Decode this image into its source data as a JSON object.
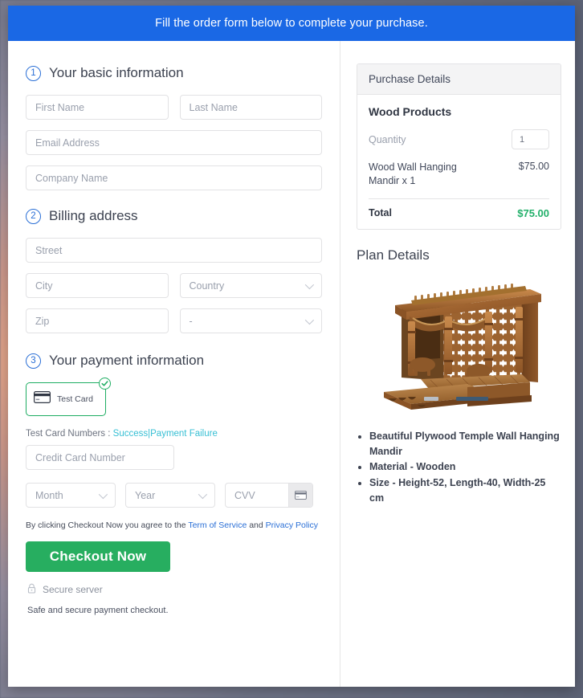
{
  "banner": {
    "text": "Fill the order form below to complete your purchase."
  },
  "sections": {
    "basic": {
      "step": "1",
      "title": "Your basic information",
      "fields": {
        "first_name": "First Name",
        "last_name": "Last Name",
        "email": "Email Address",
        "company": "Company Name"
      }
    },
    "billing": {
      "step": "2",
      "title": "Billing address",
      "fields": {
        "street": "Street",
        "city": "City",
        "country": "Country",
        "zip": "Zip",
        "state": "-"
      }
    },
    "payment": {
      "step": "3",
      "title": "Your payment information",
      "method_label": "Test Card",
      "testcards_prefix": "Test Card Numbers :",
      "testcards_success": "Success",
      "testcards_separator": "|",
      "testcards_failure": "Payment Failure",
      "fields": {
        "card_number": "Credit Card Number",
        "month": "Month",
        "year": "Year",
        "cvv": "CVV"
      }
    }
  },
  "footer": {
    "terms_prefix": "By clicking Checkout Now you agree to the",
    "terms_link": "Term of Service",
    "terms_and": "and",
    "privacy_link": "Privacy Policy",
    "checkout_label": "Checkout Now",
    "secure_server": "Secure server",
    "safe_note": "Safe and secure payment checkout."
  },
  "purchase": {
    "header": "Purchase Details",
    "product_group": "Wood Products",
    "quantity_label": "Quantity",
    "quantity_value": "1",
    "line_item_name": "Wood Wall Hanging Mandir x 1",
    "line_item_amount": "$75.00",
    "total_label": "Total",
    "total_amount": "$75.00"
  },
  "plan": {
    "title": "Plan Details",
    "bullets": [
      "Beautiful Plywood Temple Wall Hanging Mandir",
      "Material - Wooden",
      "Size - Height-52, Length-40, Width-25 cm"
    ]
  },
  "colors": {
    "banner_blue": "#1a68e5",
    "step_blue": "#2a6fd6",
    "checkout_green": "#27ae60",
    "total_green": "#22b06a",
    "chip_green": "#1ead62",
    "link_cyan": "#36bfd4",
    "link_blue": "#2a6fd6"
  }
}
